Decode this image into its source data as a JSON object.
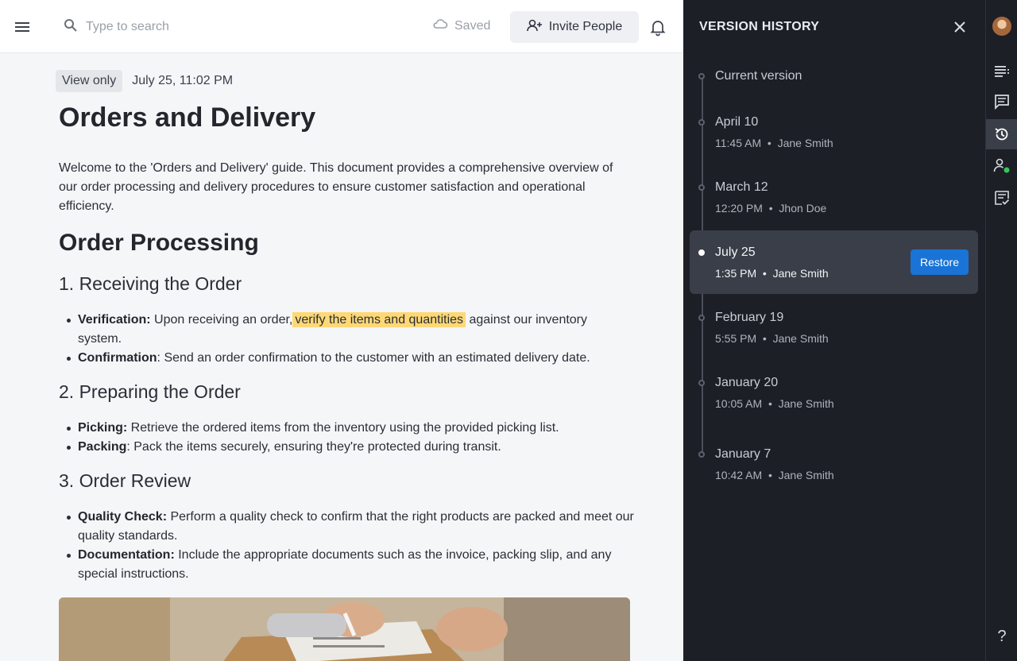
{
  "topbar": {
    "search_placeholder": "Type to search",
    "saved_label": "Saved",
    "invite_label": "Invite People"
  },
  "doc": {
    "badge": "View only",
    "timestamp": "July 25, 11:02 PM",
    "title": "Orders and Delivery",
    "intro": "Welcome to the 'Orders and Delivery' guide. This document provides a comprehensive overview of our order processing and delivery procedures to ensure customer satisfaction and operational efficiency.",
    "section_title": "Order Processing",
    "sub1": "1. Receiving the Order",
    "sub1_items": [
      {
        "bold": "Verification:",
        "pre": " Upon receiving an order,",
        "highlight": "verify the items and quantities",
        "post": " against our inventory system."
      },
      {
        "bold": "Confirmation",
        "text": ": Send an order confirmation to the customer with an estimated delivery date."
      }
    ],
    "sub2": "2. Preparing the Order",
    "sub2_items": [
      {
        "bold": "Picking:",
        "text": " Retrieve the ordered items from the inventory using the provided picking list."
      },
      {
        "bold": "Packing",
        "text": ": Pack the items securely, ensuring they're protected during transit."
      }
    ],
    "sub3": "3. Order Review",
    "sub3_items": [
      {
        "bold": "Quality Check:",
        "text": " Perform a quality check to confirm that the right products are packed and meet our quality standards."
      },
      {
        "bold": "Documentation:",
        "text": " Include the appropriate documents such as the invoice, packing slip, and any special instructions."
      }
    ]
  },
  "version_history": {
    "title": "VERSION HISTORY",
    "current": "Current version",
    "versions": [
      {
        "date": "April 10",
        "time": "11:45 AM",
        "author": "Jane Smith",
        "separator": "•"
      },
      {
        "date": "March 12",
        "time": "12:20 PM",
        "author": "Jhon Doe",
        "separator": "•"
      },
      {
        "date": "July 25",
        "time": "1:35 PM",
        "author": "Jane Smith",
        "separator": "•"
      },
      {
        "date": "February 19",
        "time": "5:55 PM",
        "author": "Jane Smith",
        "separator": "•"
      },
      {
        "date": "January 20",
        "time": "10:05 AM",
        "author": "Jane Smith",
        "separator": "•"
      },
      {
        "date": "January 7",
        "time": "10:42 AM",
        "author": "Jane Smith",
        "separator": "•"
      }
    ],
    "restore_label": "Restore"
  },
  "rail": {
    "help_label": "?"
  },
  "colors": {
    "accent": "#1a73d6",
    "highlight": "#ffd876",
    "panel_bg": "#1c1f26",
    "presence": "#34c759"
  }
}
